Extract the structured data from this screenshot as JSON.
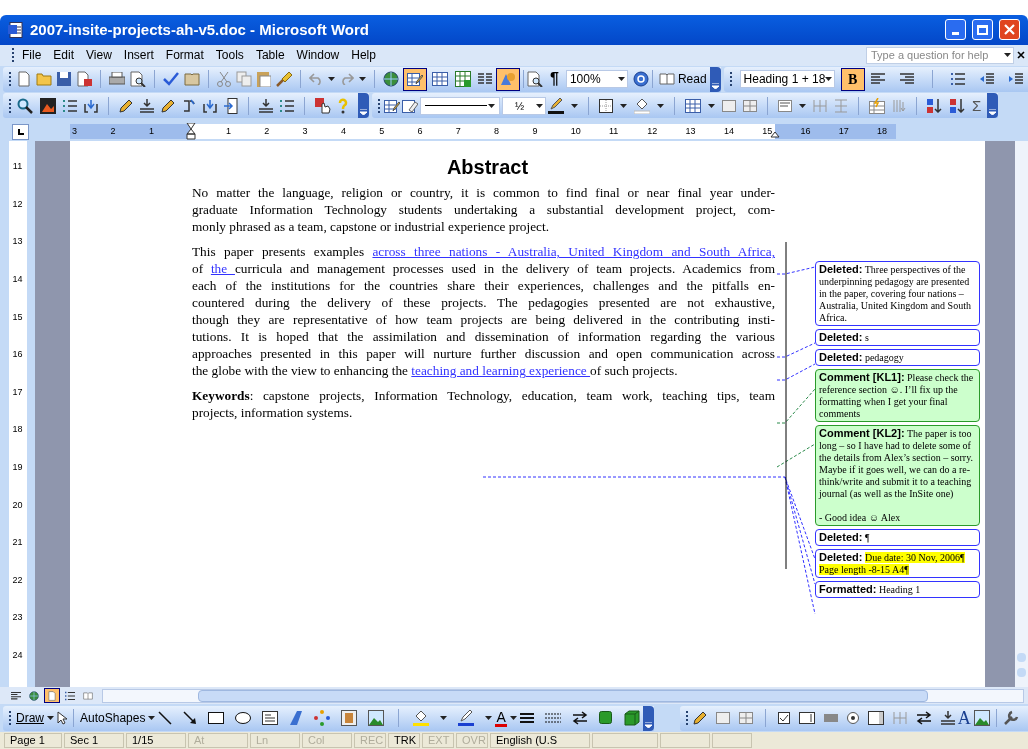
{
  "window": {
    "title": "2007-insite-projects-ah-v5.doc - Microsoft Word"
  },
  "menu": [
    "File",
    "Edit",
    "View",
    "Insert",
    "Format",
    "Tools",
    "Table",
    "Window",
    "Help"
  ],
  "help_box": {
    "placeholder": "Type a question for help"
  },
  "standard_toolbar": {
    "show_hide": "¶",
    "zoom": "100%",
    "read": "Read",
    "tables_borders_pressed": true,
    "drawing_pressed": true
  },
  "formatting_toolbar": {
    "style": "Heading 1 + 18",
    "bold": "B",
    "bold_pressed": true
  },
  "tables_toolbar": {
    "line_weight": "½",
    "sum": "Σ"
  },
  "ruler": {
    "numbers": [
      "3",
      "2",
      "1",
      "1",
      "2",
      "3",
      "4",
      "5",
      "6",
      "7",
      "8",
      "9",
      "10",
      "11",
      "12",
      "13",
      "14",
      "15",
      "16",
      "17",
      "18"
    ]
  },
  "vertical_ruler": {
    "numbers": [
      "11",
      "12",
      "13",
      "14",
      "15",
      "16",
      "17",
      "18",
      "19",
      "20",
      "21",
      "22",
      "23",
      "24"
    ]
  },
  "document": {
    "heading": "Abstract",
    "paragraphs": [
      {
        "lines": [
          [
            {
              "text": "No matter the language, religion or country, it is common to find final or near final year under-",
              "inserted": false
            }
          ],
          [
            {
              "text": "graduate Information Technology students undertaking a substantial development project, com-",
              "inserted": false
            }
          ],
          [
            {
              "text": "monly phrased as a team, capstone or industrial experience project.",
              "inserted": false
            }
          ]
        ]
      },
      {
        "lines": [
          [
            {
              "text": "This paper presents examples ",
              "inserted": false
            },
            {
              "text": "across three nations - Australia, United Kingdom and South Africa,",
              "inserted": true
            }
          ],
          [
            {
              "text": "of ",
              "inserted": false
            },
            {
              "text": "the ",
              "inserted": true
            },
            {
              "text": "curricula and management processes used in the delivery of team projects. Academics from",
              "inserted": false
            }
          ],
          [
            {
              "text": "each of the institutions for the countries share their experiences, challenges and the pitfalls en-",
              "inserted": false
            }
          ],
          [
            {
              "text": "countered during the delivery of these projects. The pedagogies presented are not exhaustive,",
              "inserted": false
            }
          ],
          [
            {
              "text": "though they are representative of how team projects are being delivered in the contributing insti-",
              "inserted": false
            }
          ],
          [
            {
              "text": "tutions. It is hoped that the assimilation and dissemination of information regarding the various",
              "inserted": false
            }
          ],
          [
            {
              "text": "approaches presented in this paper will nurture further discussion and open communication across",
              "inserted": false
            }
          ],
          [
            {
              "text": "the globe with the view to enhancing the ",
              "inserted": false
            },
            {
              "text": "teaching and learning experience ",
              "inserted": true
            },
            {
              "text": "of such projects.",
              "inserted": false
            }
          ]
        ]
      },
      {
        "lines": [
          [
            {
              "text": "**Keywords**: capstone projects, Information Technology, education, team work, teaching tips, team",
              "inserted": false
            }
          ],
          [
            {
              "text": "projects, information systems.",
              "inserted": false
            }
          ]
        ]
      }
    ]
  },
  "balloons": [
    {
      "kind": "deleted",
      "label": "Deleted:",
      "text": "Three perspectives of the underpinning pedagogy are presented in the paper, covering four nations – Australia, United Kingdom and South Africa.",
      "highlighted": false
    },
    {
      "kind": "deleted",
      "label": "Deleted:",
      "text": "s",
      "highlighted": false
    },
    {
      "kind": "deleted",
      "label": "Deleted:",
      "text": "pedagogy",
      "highlighted": false
    },
    {
      "kind": "comment",
      "label": "Comment [KL1]:",
      "text": "Please check the reference section ☺. I’ll fix up the formatting when I get your final comments",
      "highlighted": false
    },
    {
      "kind": "comment",
      "label": "Comment [KL2]:",
      "text": "The paper is too long – so I have had to delete some of the details from Alex’s section – sorry. Maybe if it goes well, we can do a re-think/write and submit it to a teaching journal (as well as the InSite one)\n\n- Good idea ☺ Alex",
      "highlighted": false
    },
    {
      "kind": "deleted",
      "label": "Deleted:",
      "text": "¶",
      "highlighted": false
    },
    {
      "kind": "deleted",
      "label": "Deleted:",
      "text": "Due date: 30 Nov, 2006¶ Page length -8-15 A4¶",
      "highlighted": true
    },
    {
      "kind": "formatted",
      "label": "Formatted:",
      "text": "Heading 1",
      "highlighted": false
    }
  ],
  "view_buttons": [
    {
      "kind": "normal",
      "selected": false
    },
    {
      "kind": "web",
      "selected": false
    },
    {
      "kind": "print",
      "selected": true
    },
    {
      "kind": "outline",
      "selected": false
    },
    {
      "kind": "reading",
      "selected": false
    }
  ],
  "drawing_toolbar": {
    "draw": "Draw",
    "autoshapes": "AutoShapes",
    "font_color": "A",
    "label_tool": "A"
  },
  "status_bar": [
    {
      "text": "Page 1",
      "dimmed": false
    },
    {
      "text": "Sec 1",
      "dimmed": false
    },
    {
      "text": "1/15",
      "dimmed": false
    },
    {
      "text": "At",
      "dimmed": true
    },
    {
      "text": "Ln",
      "dimmed": true
    },
    {
      "text": "Col",
      "dimmed": true
    },
    {
      "text": "REC",
      "dimmed": true
    },
    {
      "text": "TRK",
      "dimmed": false
    },
    {
      "text": "EXT",
      "dimmed": true
    },
    {
      "text": "OVR",
      "dimmed": true
    },
    {
      "text": "English (U.S",
      "dimmed": false
    }
  ]
}
